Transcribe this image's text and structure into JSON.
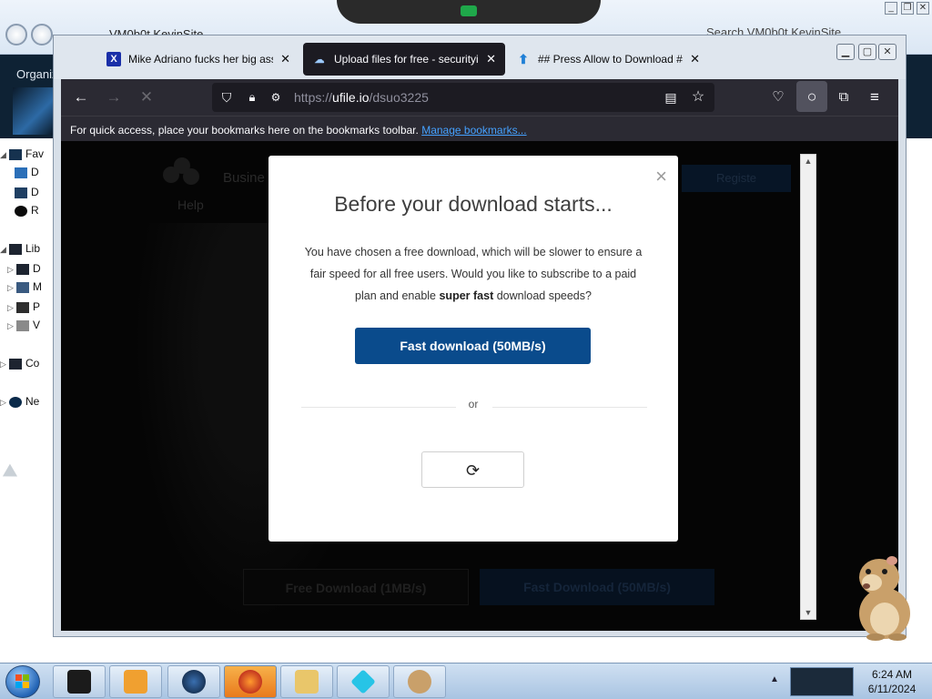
{
  "explorer": {
    "title": "VM0b0t KevinSite",
    "search_placeholder": "Search VM0b0t KevinSite",
    "organize_label": "Organiz",
    "tree": [
      {
        "label": "Fav"
      },
      {
        "label": "D"
      },
      {
        "label": "D"
      },
      {
        "label": "R"
      },
      {
        "label": "Lib"
      },
      {
        "label": "D"
      },
      {
        "label": "M"
      },
      {
        "label": "P"
      },
      {
        "label": "V"
      },
      {
        "label": "Co"
      },
      {
        "label": "Ne"
      }
    ]
  },
  "browser": {
    "tabs": [
      {
        "label": "Mike Adriano fucks her big ass",
        "icon": "x-logo-icon",
        "active": false
      },
      {
        "label": "Upload files for free - securityig",
        "icon": "cloud-icon",
        "active": true
      },
      {
        "label": "## Press Allow to Download ##",
        "icon": "upload-icon",
        "active": false
      }
    ],
    "url": {
      "scheme": "https://",
      "host": "ufile.io",
      "path": "/dsuo3225"
    },
    "bookmarks_bar": {
      "message": "For quick access, place your bookmarks here on the bookmarks toolbar.",
      "link": "Manage bookmarks..."
    }
  },
  "page": {
    "background": {
      "business_label": "Busine",
      "help_label": "Help",
      "register_label": "Registe",
      "free_download_label": "Free Download (1MB/s)",
      "fast_download_label": "Fast Download (50MB/s)"
    },
    "modal": {
      "close_label": "×",
      "title": "Before your download starts...",
      "body_pre": "You have chosen a free download, which will be slower to ensure a fair speed for all free users. Would you like to subscribe to a paid plan and enable ",
      "body_bold": "super fast",
      "body_post": " download speeds?",
      "primary_button": "Fast download (50MB/s)",
      "divider_text": "or",
      "retry_icon": "refresh-icon"
    }
  },
  "taskbar": {
    "items": [
      {
        "icon": "monitor-icon"
      },
      {
        "icon": "media-player-icon"
      },
      {
        "icon": "globe-icon"
      },
      {
        "icon": "firefox-icon"
      },
      {
        "icon": "file-explorer-icon"
      },
      {
        "icon": "diamond-icon"
      },
      {
        "icon": "hamster-icon"
      }
    ],
    "clock_time": "6:24 AM",
    "clock_date": "6/11/2024"
  },
  "colors": {
    "accent_button": "#0a4b8c",
    "firefox_chrome": "#2b2a33",
    "link": "#45a1ff"
  }
}
